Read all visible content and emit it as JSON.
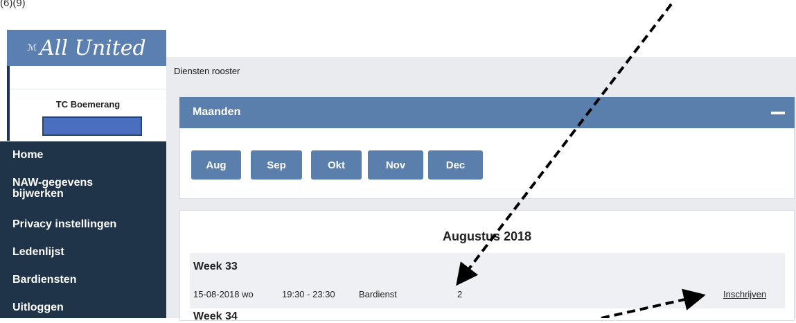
{
  "corner_label": "(6)(9)",
  "logo": {
    "text": "All United",
    "mark": "ℳ"
  },
  "club": {
    "name": "TC Boemerang"
  },
  "nav": {
    "items": [
      {
        "label": "Home"
      },
      {
        "label": "NAW-gegevens"
      },
      {
        "label": "bijwerken"
      },
      {
        "label": "Privacy instellingen"
      },
      {
        "label": "Ledenlijst"
      },
      {
        "label": "Bardiensten"
      },
      {
        "label": "Uitloggen"
      }
    ]
  },
  "main": {
    "page_title": "Diensten rooster",
    "months_panel": {
      "title": "Maanden",
      "collapse_icon": "minus-icon"
    },
    "months": [
      {
        "label": "Aug"
      },
      {
        "label": "Sep"
      },
      {
        "label": "Okt"
      },
      {
        "label": "Nov"
      },
      {
        "label": "Dec"
      }
    ],
    "month_title": "Augustus 2018",
    "week": {
      "title": "Week 33",
      "row": {
        "date": "15-08-2018 wo",
        "time": "19:30 - 23:30",
        "type": "Bardienst",
        "count": "2",
        "action": "Inschrijven"
      }
    },
    "next_week": "Week 34"
  },
  "colors": {
    "accent": "#5a7fac",
    "sidebar": "#1f3349",
    "background": "#e9ebee",
    "annotation": "#000000"
  }
}
